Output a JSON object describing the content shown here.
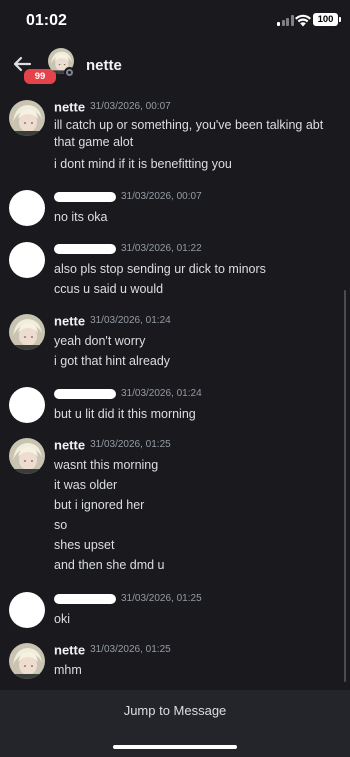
{
  "status_bar": {
    "time": "01:02",
    "battery": "100"
  },
  "header": {
    "unread_count": "99",
    "title": "nette"
  },
  "messages": [
    {
      "author": "nette",
      "timestamp": "31/03/2026, 00:07",
      "lines": [
        "ill catch up or something, you've been talking abt that game alot",
        "i dont mind if it is benefitting you"
      ]
    },
    {
      "author": "",
      "timestamp": "31/03/2026, 00:07",
      "lines": [
        "no its oka"
      ]
    },
    {
      "author": "",
      "timestamp": "31/03/2026, 01:22",
      "lines": [
        "also pls stop sending ur dick to minors",
        "ccus u said u would"
      ]
    },
    {
      "author": "nette",
      "timestamp": "31/03/2026, 01:24",
      "lines": [
        "yeah don't worry",
        "i got that hint already"
      ]
    },
    {
      "author": "",
      "timestamp": "31/03/2026, 01:24",
      "lines": [
        "but u lit did it this morning"
      ]
    },
    {
      "author": "nette",
      "timestamp": "31/03/2026, 01:25",
      "lines": [
        "wasnt this morning",
        "it was older",
        "but i ignored her",
        "so",
        "shes upset",
        "and then she dmd u"
      ]
    },
    {
      "author": "",
      "timestamp": "31/03/2026, 01:25",
      "lines": [
        "oki"
      ]
    },
    {
      "author": "nette",
      "timestamp": "31/03/2026, 01:25",
      "lines": [
        "mhm"
      ]
    }
  ],
  "footer": {
    "jump_label": "Jump to Message"
  },
  "icons": {
    "back": "arrow-left-icon",
    "signal": "cellular-signal-icon",
    "wifi": "wifi-icon",
    "battery": "battery-icon"
  },
  "colors": {
    "background": "#1a1a1e",
    "footer": "#24252a",
    "badge": "#e4434a",
    "timestamp": "#949ba4"
  }
}
